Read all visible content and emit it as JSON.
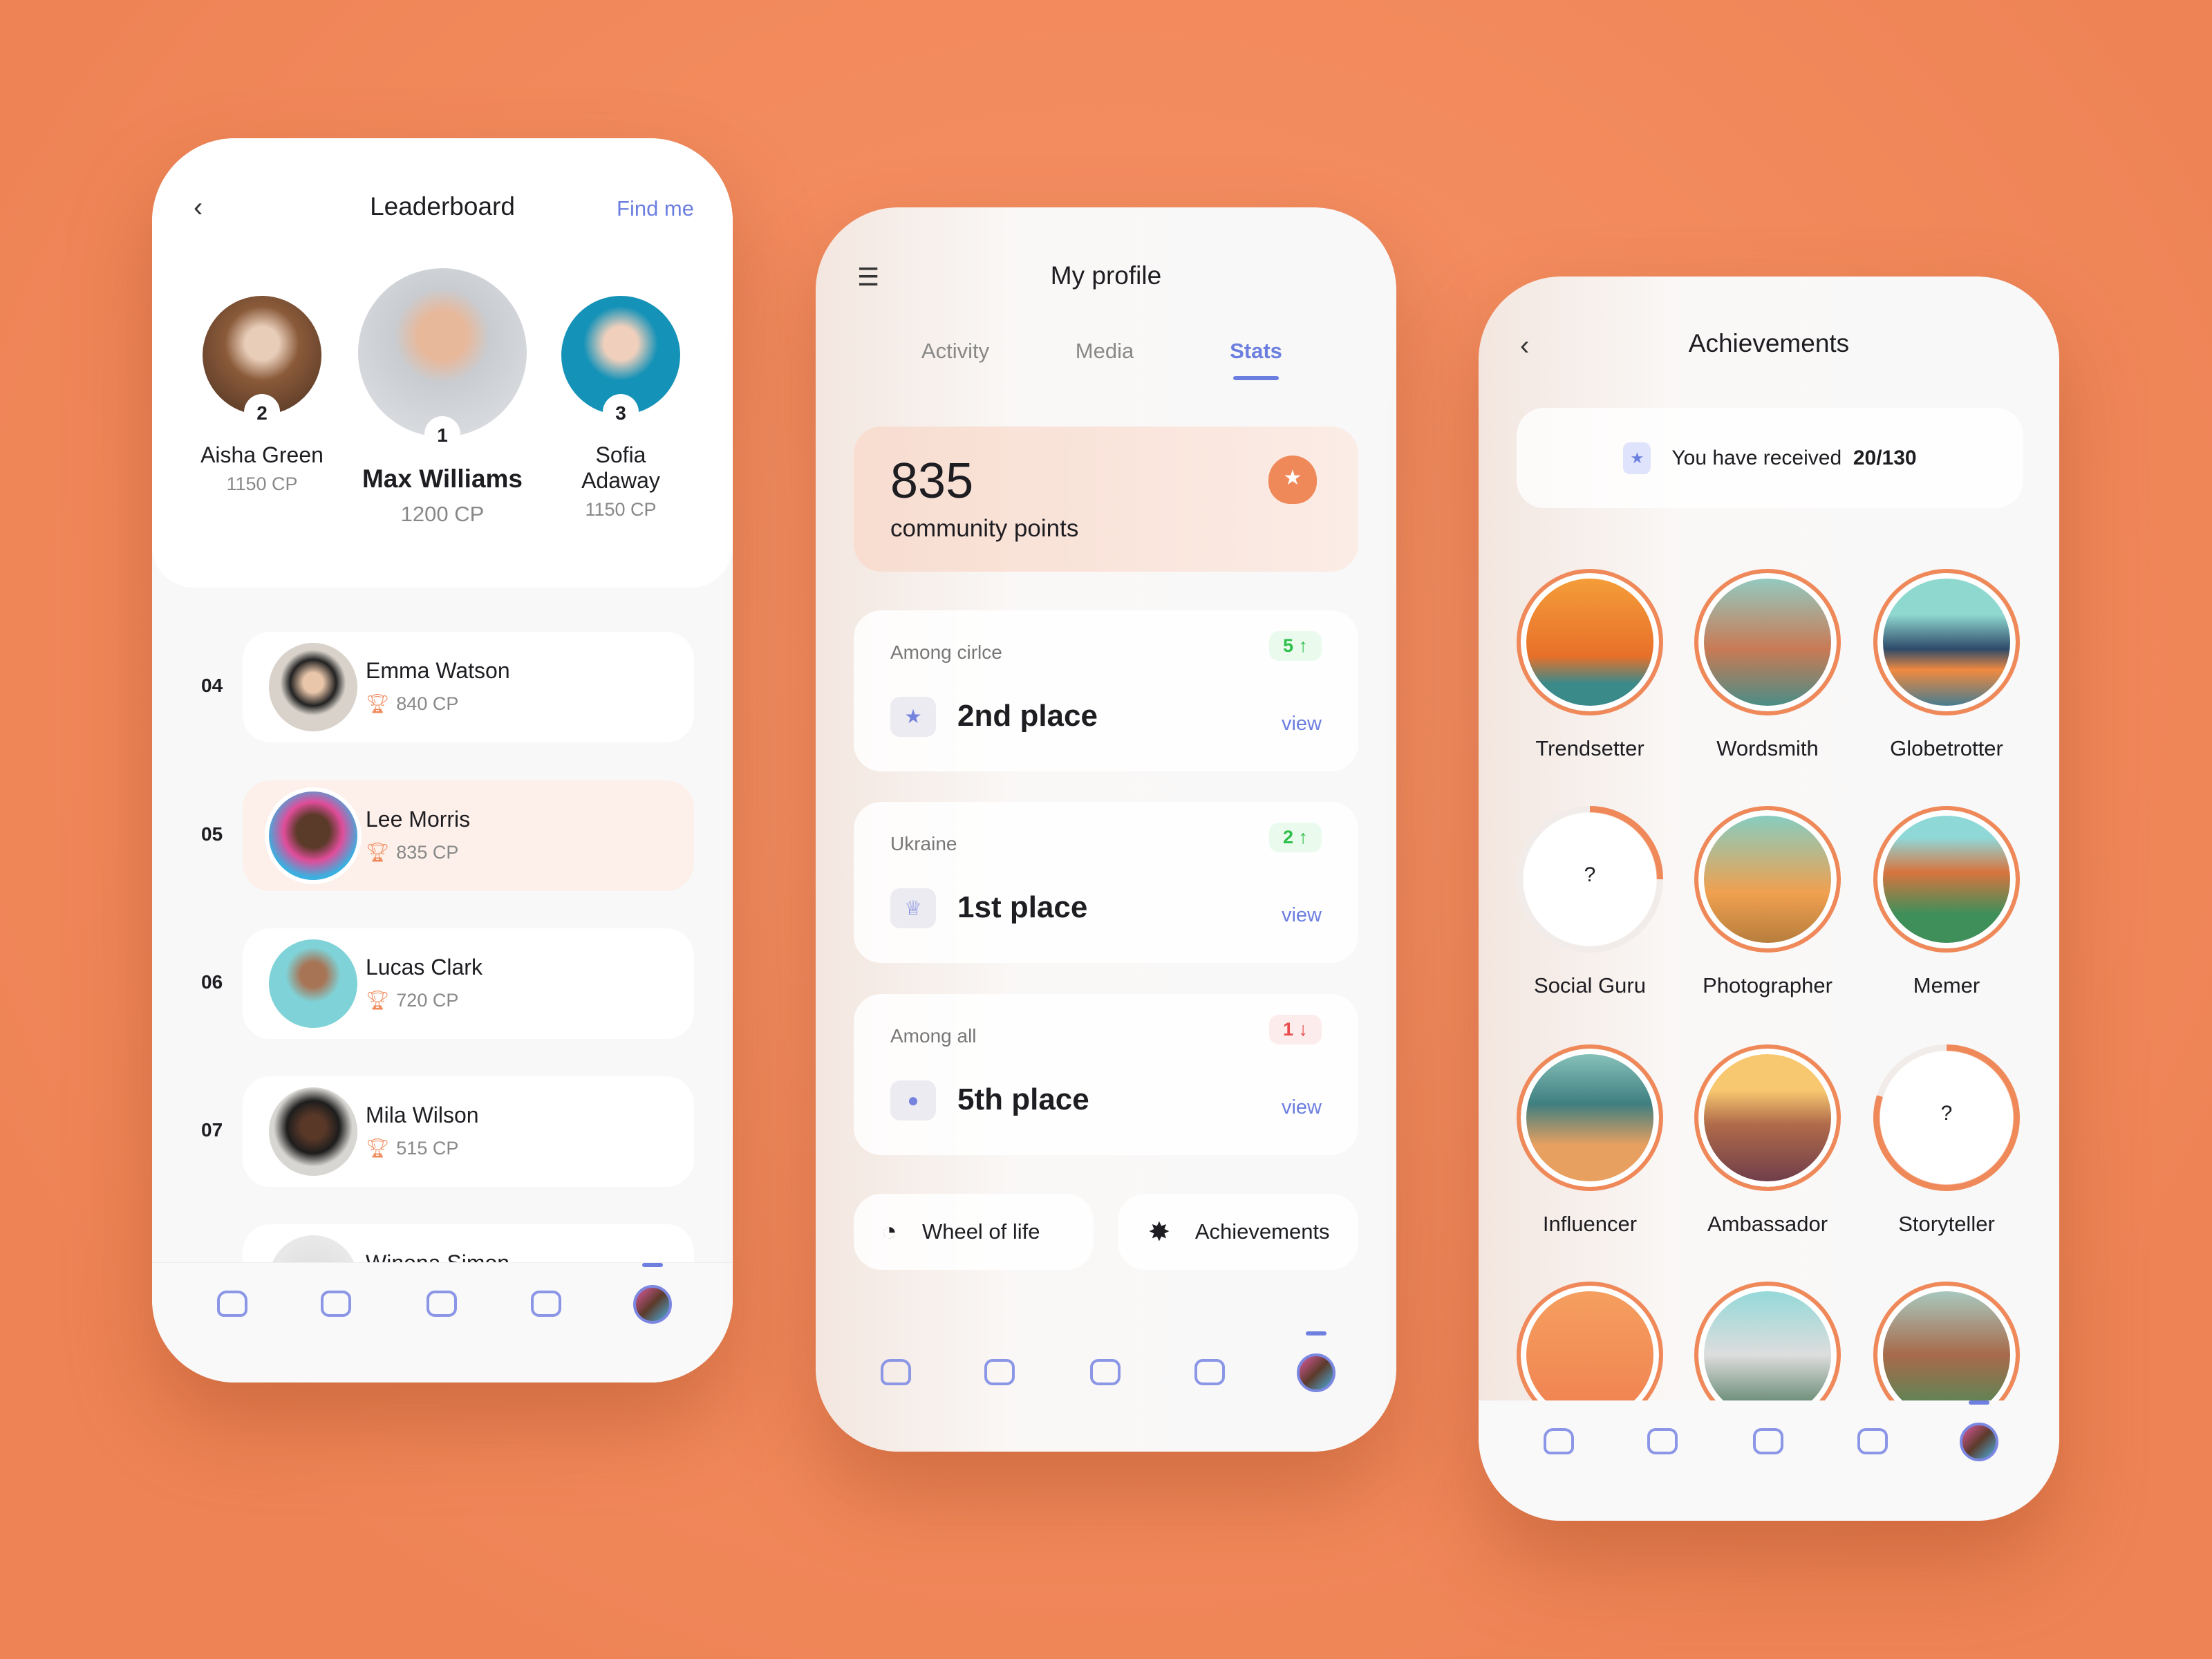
{
  "leaderboard": {
    "title": "Leaderboard",
    "find_me": "Find me",
    "podium": [
      {
        "rank": "2",
        "name": "Aisha Green",
        "cp": "1150 CP"
      },
      {
        "rank": "1",
        "name": "Max Williams",
        "cp": "1200 CP"
      },
      {
        "rank": "3",
        "name": "Sofia Adaway",
        "cp": "1150 CP"
      }
    ],
    "rows": [
      {
        "rank": "04",
        "name": "Emma Watson",
        "cp": "840 CP"
      },
      {
        "rank": "05",
        "name": "Lee Morris",
        "cp": "835 CP",
        "current": true
      },
      {
        "rank": "06",
        "name": "Lucas Clark",
        "cp": "720 CP"
      },
      {
        "rank": "07",
        "name": "Mila Wilson",
        "cp": "515 CP"
      },
      {
        "rank": "",
        "name": "Winona Simon",
        "cp": ""
      }
    ]
  },
  "profile": {
    "title": "My profile",
    "tabs": [
      "Activity",
      "Media",
      "Stats"
    ],
    "active_tab": "Stats",
    "points": {
      "value": "835",
      "label": "community points"
    },
    "stats": [
      {
        "label": "Among cirlce",
        "place": "2nd place",
        "change": "5",
        "dir": "up",
        "icon": "medal-icon",
        "view": "view"
      },
      {
        "label": "Ukraine",
        "place": "1st place",
        "change": "2",
        "dir": "up",
        "icon": "crown-icon",
        "view": "view"
      },
      {
        "label": "Among all",
        "place": "5th place",
        "change": "1",
        "dir": "down",
        "icon": "award-icon",
        "view": "view"
      }
    ],
    "buttons": {
      "wheel": "Wheel of life",
      "achievements": "Achievements"
    }
  },
  "achievements": {
    "title": "Achievements",
    "received_label": "You have received",
    "received_count": "20/130",
    "items": [
      {
        "name": "Trendsetter",
        "locked": false
      },
      {
        "name": "Wordsmith",
        "locked": false
      },
      {
        "name": "Globetrotter",
        "locked": false
      },
      {
        "name": "Social Guru",
        "locked": true,
        "progress": 0.25
      },
      {
        "name": "Photographer",
        "locked": false
      },
      {
        "name": "Memer",
        "locked": false
      },
      {
        "name": "Influencer",
        "locked": false
      },
      {
        "name": "Ambassador",
        "locked": false
      },
      {
        "name": "Storyteller",
        "locked": true,
        "progress": 0.8
      },
      {
        "name": "",
        "locked": false
      },
      {
        "name": "",
        "locked": false
      },
      {
        "name": "",
        "locked": false
      }
    ],
    "locked_symbol": "?"
  },
  "colors": {
    "accent": "#6c7fe0",
    "orange": "#f0895a",
    "up": "#2fbf4b",
    "down": "#ea4b4b"
  }
}
